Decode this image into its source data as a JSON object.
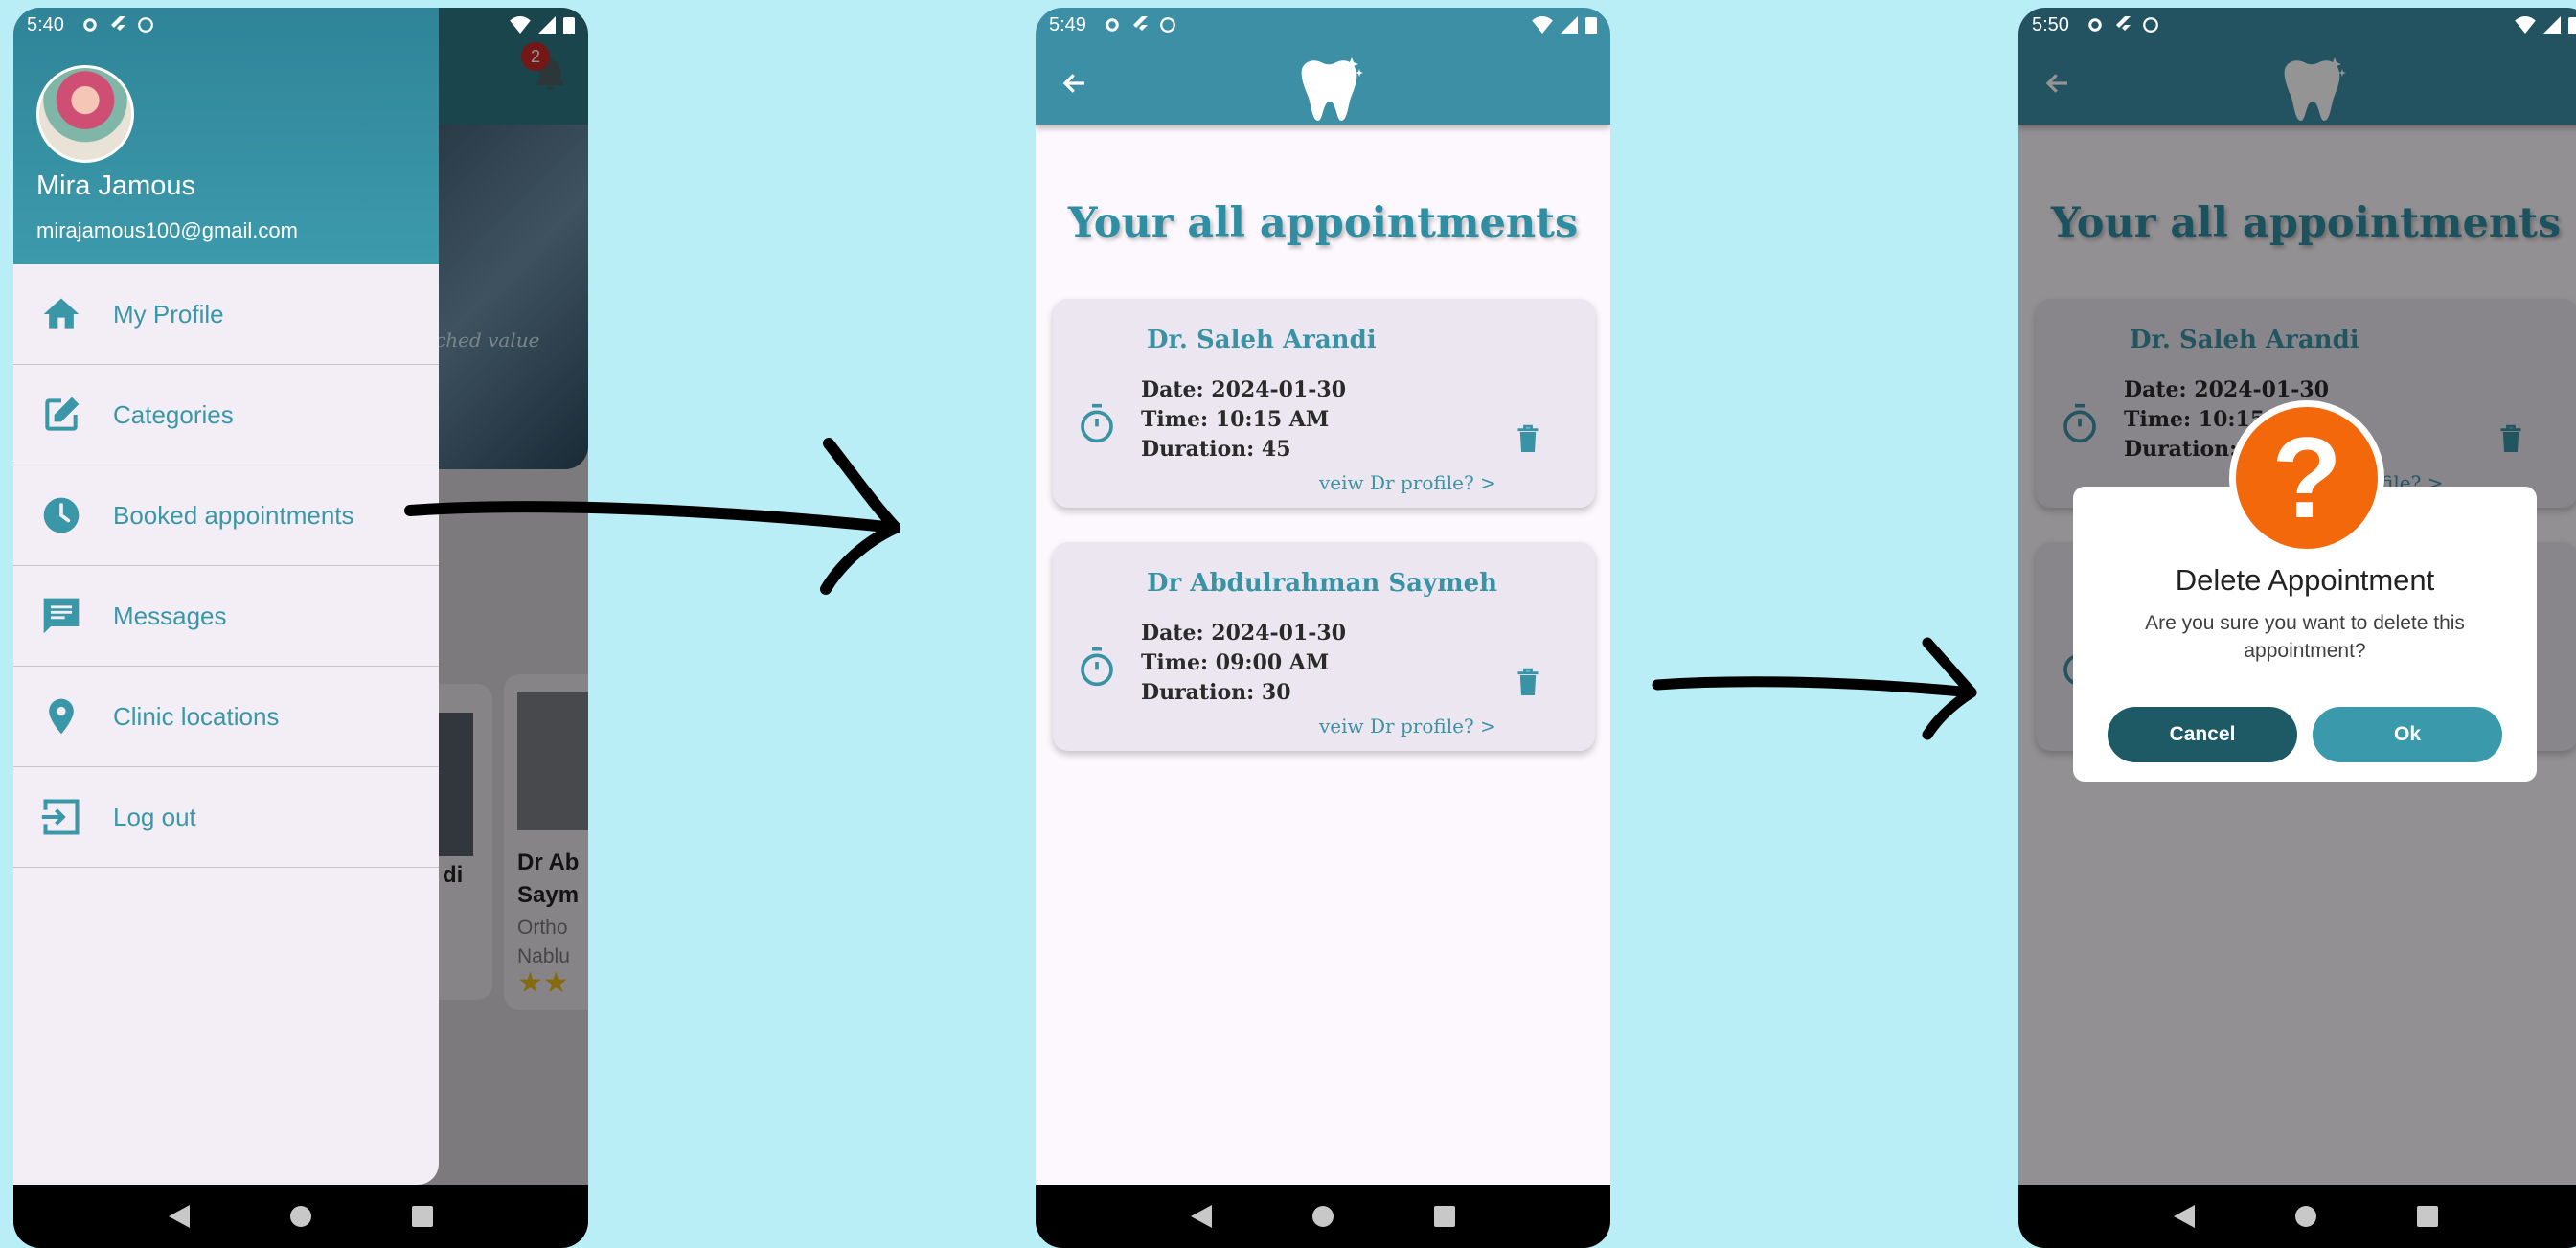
{
  "colors": {
    "background": "#b9eef6",
    "primary": "#3d8fa5",
    "drawer_header": "#2f8497",
    "accent_text": "#3a97a8",
    "dialog_icon": "#f2680b",
    "cancel_button": "#1d5a66",
    "ok_button": "#3a9aab"
  },
  "screen1": {
    "status_time": "5:40",
    "badge_count": "2",
    "hero_text": "ched value",
    "card1_name": "di",
    "card2_name_line1": "Dr Ab",
    "card2_name_line2": "Saym",
    "card2_specialty": "Ortho",
    "card2_city": "Nablu",
    "user": {
      "name": "Mira Jamous",
      "email": "mirajamous100@gmail.com"
    },
    "drawer_items": [
      {
        "label": "My Profile",
        "icon": "home-icon"
      },
      {
        "label": "Categories",
        "icon": "edit-icon"
      },
      {
        "label": "Booked appointments",
        "icon": "clock-icon"
      },
      {
        "label": "Messages",
        "icon": "message-icon"
      },
      {
        "label": "Clinic locations",
        "icon": "location-pin-icon"
      },
      {
        "label": "Log out",
        "icon": "logout-icon"
      }
    ]
  },
  "screen2": {
    "status_time": "5:49",
    "page_title": "Your all appointments",
    "appointments": [
      {
        "doctor": "Dr. Saleh Arandi",
        "date": "Date: 2024-01-30",
        "time": "Time: 10:15 AM",
        "duration": "Duration: 45",
        "link": "veiw Dr profile? >"
      },
      {
        "doctor": "Dr Abdulrahman Saymeh",
        "date": "Date: 2024-01-30",
        "time": "Time: 09:00 AM",
        "duration": "Duration: 30",
        "link": "veiw Dr profile? >"
      }
    ]
  },
  "screen3": {
    "status_time": "5:50",
    "page_title": "Your all appointments",
    "doctor": "Dr. Saleh Arandi",
    "date": "Date: 2024-01-30",
    "time": "Time: 10:15 A",
    "duration": "Duration: 4",
    "link": "file? >",
    "dialog": {
      "icon_glyph": "?",
      "title": "Delete Appointment",
      "message": "Are you sure you want to delete this appointment?",
      "cancel_label": "Cancel",
      "ok_label": "Ok"
    }
  }
}
